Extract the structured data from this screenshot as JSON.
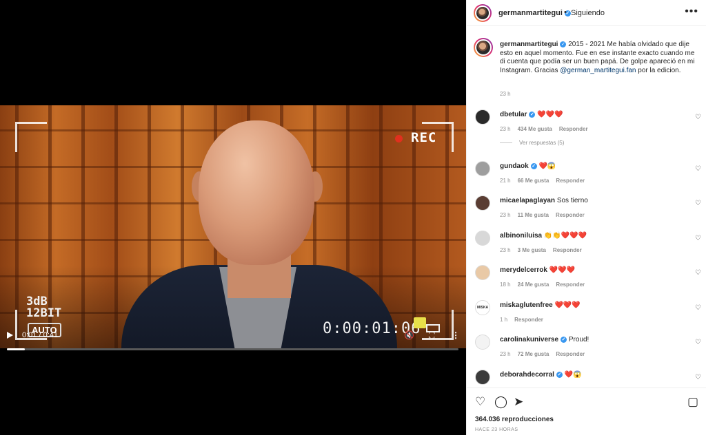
{
  "video": {
    "overlay": {
      "rec_label": "REC",
      "audio_line1": "3dB",
      "audio_line2": "12BIT",
      "auto_label": "AUTO",
      "timecode": "0:00:01:06"
    },
    "player": {
      "time_label": "0:01 / 0:41",
      "progress": 0.04,
      "play_icon": "play-icon",
      "mute_icon": "mute-icon",
      "fullscreen_icon": "fullscreen-icon",
      "more_icon": "more-icon"
    }
  },
  "header": {
    "username": "germanmartitegui",
    "separator": "•",
    "follow_label": "Siguiendo",
    "more": "•••"
  },
  "caption": {
    "username": "germanmartitegui",
    "text_before": " 2015 - 2021 Me había olvidado que dije esto en aquel momento. Fue en ese instante exacto cuando me di cuenta que podía ser un buen papá. De golpe apareció en mi Instagram. Gracias ",
    "mention": "@german_martitegui.fan",
    "text_after": " por la edicion.",
    "time": "23 h"
  },
  "comments": [
    {
      "username": "dbetular",
      "verified": true,
      "text": "❤️❤️❤️",
      "time": "23 h",
      "likes": "434 Me gusta",
      "reply": "Responder",
      "replies_label": "Ver respuestas (5)",
      "avatar_color": "#2a2a2a"
    },
    {
      "username": "gundaok",
      "verified": true,
      "text": "❤️😱",
      "time": "21 h",
      "likes": "66 Me gusta",
      "reply": "Responder",
      "avatar_color": "#9e9e9e"
    },
    {
      "username": "micaelapaglayan",
      "verified": false,
      "text": "Sos tierno",
      "time": "23 h",
      "likes": "11 Me gusta",
      "reply": "Responder",
      "avatar_color": "#5a3d33"
    },
    {
      "username": "albinoniluisa",
      "verified": false,
      "text": "👏👏❤️❤️❤️",
      "time": "23 h",
      "likes": "3 Me gusta",
      "reply": "Responder",
      "avatar_color": "#d8d8d8"
    },
    {
      "username": "merydelcerrok",
      "verified": false,
      "text": "❤️❤️❤️",
      "time": "18 h",
      "likes": "24 Me gusta",
      "reply": "Responder",
      "avatar_color": "#e9c9a6"
    },
    {
      "username": "miskaglutenfree",
      "verified": false,
      "text": "❤️❤️❤️",
      "time": "1 h",
      "likes": "",
      "reply": "Responder",
      "avatar_color": "#ffffff",
      "avatar_text": "MISKA"
    },
    {
      "username": "carolinakuniverse",
      "verified": true,
      "text": "Proud!",
      "time": "23 h",
      "likes": "72 Me gusta",
      "reply": "Responder",
      "avatar_color": "#f3f3f3"
    },
    {
      "username": "deborahdecorral",
      "verified": true,
      "text": "❤️😱",
      "time": "",
      "likes": "",
      "reply": "",
      "avatar_color": "#3b3b3b"
    }
  ],
  "actions": {
    "like_icon": "heart-icon",
    "comment_icon": "comment-icon",
    "share_icon": "share-icon",
    "save_icon": "bookmark-icon",
    "views": "364.036 reproducciones",
    "ago": "HACE 23 HORAS"
  },
  "colors": {
    "accent": "#3897f0",
    "mention": "#00376b",
    "muted": "#8e8e8e",
    "heart": "#ed4956"
  }
}
